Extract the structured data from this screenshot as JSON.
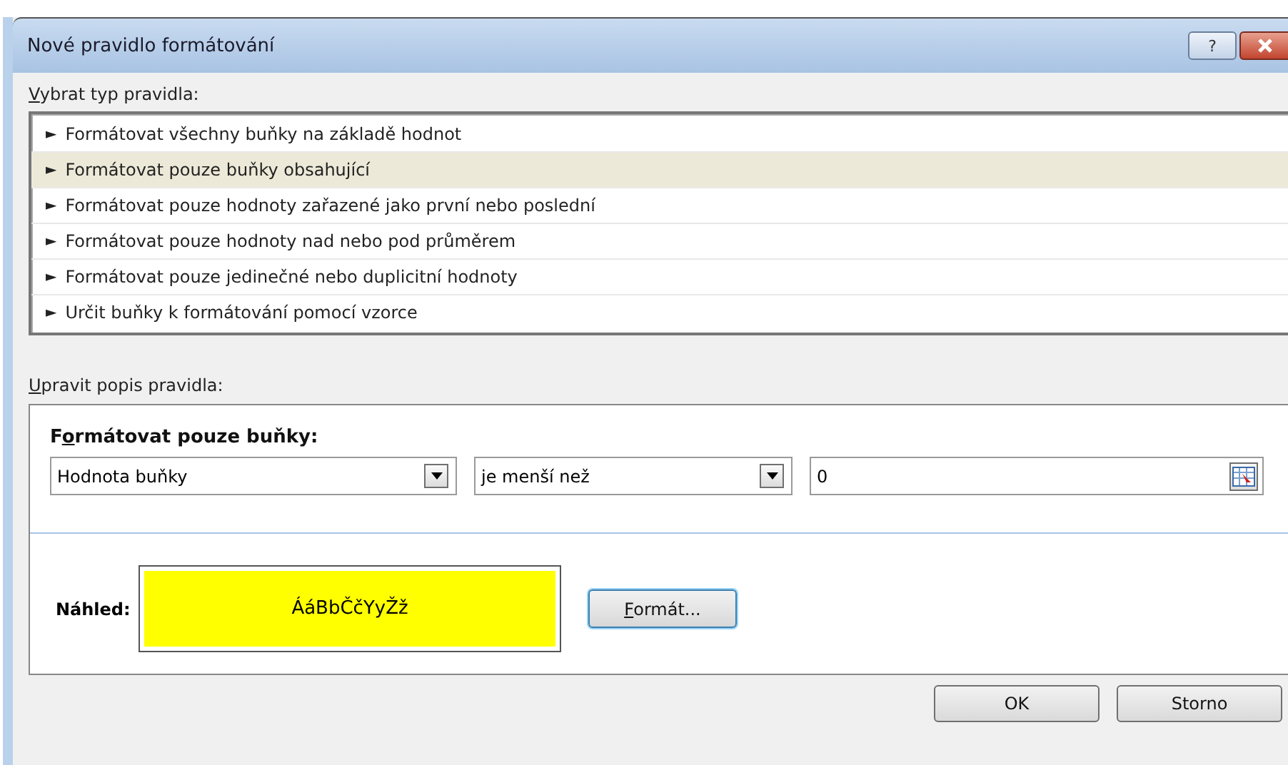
{
  "window": {
    "title": "Nové pravidlo formátování",
    "help_button": "?"
  },
  "rule_types": {
    "label": {
      "key": "V",
      "after": "ybrat typ pravidla:"
    },
    "items": [
      {
        "marker": "►",
        "text": "Formátovat všechny buňky na základě hodnot",
        "selected": false
      },
      {
        "marker": "►",
        "text": "Formátovat pouze buňky obsahující",
        "selected": true
      },
      {
        "marker": "►",
        "text": "Formátovat pouze hodnoty zařazené jako první nebo poslední",
        "selected": false
      },
      {
        "marker": "►",
        "text": "Formátovat pouze hodnoty nad nebo pod průměrem",
        "selected": false
      },
      {
        "marker": "►",
        "text": "Formátovat pouze jedinečné nebo duplicitní hodnoty",
        "selected": false
      },
      {
        "marker": "►",
        "text": "Určit buňky k formátování pomocí vzorce",
        "selected": false
      }
    ]
  },
  "rule_description": {
    "label": {
      "key": "U",
      "after": "pravit popis pravidla:"
    },
    "heading": {
      "before": "F",
      "key": "o",
      "after": "rmátovat pouze buňky:"
    },
    "condition": {
      "field": "Hodnota buňky",
      "operator": "je menší než",
      "value": "0"
    },
    "preview": {
      "label": "Náhled:",
      "sample": "ÁáBbČčYyŽž",
      "color": "#ffff00"
    },
    "format_button": {
      "key": "F",
      "after": "ormát..."
    }
  },
  "buttons": [
    "OK",
    "Storno"
  ]
}
